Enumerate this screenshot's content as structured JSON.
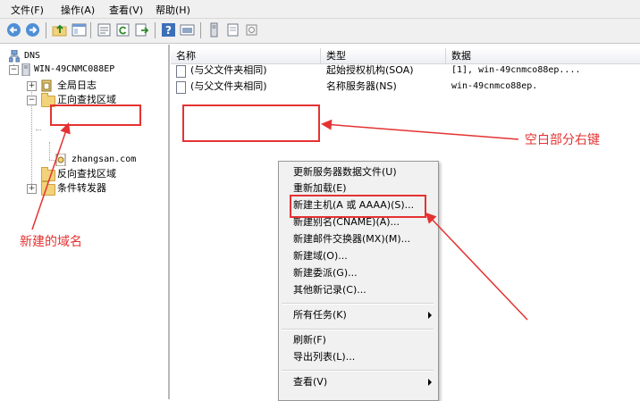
{
  "menu": {
    "file": "文件(F)",
    "action": "操作(A)",
    "view": "查看(V)",
    "help": "帮助(H)"
  },
  "toolbar": {
    "buttons": [
      "back-icon",
      "forward-icon",
      "up-icon",
      "show-tree-icon",
      "properties-icon",
      "refresh-icon",
      "export-icon",
      "help-icon",
      "console-icon",
      "server-icon",
      "record-icon",
      "zone-icon"
    ]
  },
  "tree": {
    "root": "DNS",
    "server": "WIN-49CNMC088EP",
    "global_logs": "全局日志",
    "forward_zones": "正向查找区域",
    "zone": "zhangsan.com",
    "reverse_zones": "反向查找区域",
    "conditional_forwarders": "条件转发器"
  },
  "list": {
    "columns": [
      "名称",
      "类型",
      "数据"
    ],
    "rows": [
      {
        "name": "(与父文件夹相同)",
        "type": "起始授权机构(SOA)",
        "data": "[1], win-49cnmco88ep...."
      },
      {
        "name": "(与父文件夹相同)",
        "type": "名称服务器(NS)",
        "data": "win-49cnmco88ep."
      }
    ]
  },
  "context_menu": {
    "update_server_file": "更新服务器数据文件(U)",
    "reload": "重新加载(E)",
    "new_host": "新建主机(A 或 AAAA)(S)...",
    "new_alias": "新建别名(CNAME)(A)...",
    "new_mx": "新建邮件交换器(MX)(M)...",
    "new_domain": "新建域(O)...",
    "new_delegation": "新建委派(G)...",
    "other_records": "其他新记录(C)...",
    "all_tasks": "所有任务(K)",
    "refresh": "刷新(F)",
    "export_list": "导出列表(L)...",
    "view": "查看(V)"
  },
  "annotations": {
    "right_click_label": "空白部分右键",
    "new_domain_label": "新建的域名",
    "color": "#e53232"
  }
}
